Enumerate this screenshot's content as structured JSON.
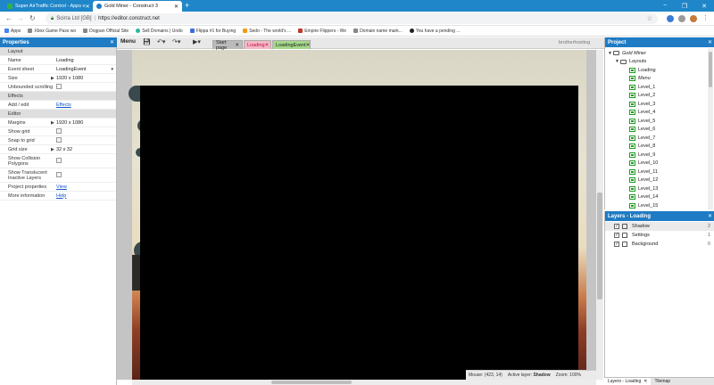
{
  "browser": {
    "tabs": [
      {
        "title": "Super AirTraffic Control - Apps o",
        "color": "#2fb34a"
      },
      {
        "title": "Gold Miner - Construct 3",
        "color": "#1e7bc4"
      }
    ],
    "new_tab": "+",
    "window_controls": [
      "−",
      "❐",
      "✕"
    ],
    "site_name": "Scirra Ltd [GB]",
    "url": "https://editor.construct.net",
    "bookmarks": [
      {
        "label": "Apps",
        "color": "#4285f4"
      },
      {
        "label": "Xbox Game Pass wo",
        "color": "#888"
      },
      {
        "label": "Dogpan Official Site",
        "color": "#888"
      },
      {
        "label": "Sell Domains | Undo",
        "color": "#2cb5a0"
      },
      {
        "label": "Flippa #1 for Buying",
        "color": "#3b6edc"
      },
      {
        "label": "Sedo - The world's ...",
        "color": "#f39c12"
      },
      {
        "label": "Empire Flippers - We",
        "color": "#c0392b"
      },
      {
        "label": "Domain name mark...",
        "color": "#888"
      },
      {
        "label": "You have a pending ...",
        "color": "#222"
      }
    ]
  },
  "editor": {
    "menu_label": "Menu",
    "layout_tabs": [
      {
        "label": "Start page"
      },
      {
        "label": "Loading"
      },
      {
        "label": "LoadingEvent"
      }
    ],
    "username": "brotherhosting"
  },
  "properties": {
    "title": "Properties",
    "rows": [
      {
        "type": "section",
        "label": "Layout"
      },
      {
        "type": "text",
        "label": "Name",
        "value": "Loading"
      },
      {
        "type": "dropdown",
        "label": "Event sheet",
        "value": "LoadingEvent"
      },
      {
        "type": "text",
        "label": "Size",
        "value": "1920 x 1080",
        "expand": true
      },
      {
        "type": "check",
        "label": "Unbounded scrolling"
      },
      {
        "type": "section",
        "label": "Effects"
      },
      {
        "type": "link",
        "label": "Add / edit",
        "value": "Effects"
      },
      {
        "type": "section",
        "label": "Editor"
      },
      {
        "type": "text",
        "label": "Margins",
        "value": "1920 x 1080",
        "expand": true
      },
      {
        "type": "check",
        "label": "Show grid"
      },
      {
        "type": "check",
        "label": "Snap to grid"
      },
      {
        "type": "text",
        "label": "Grid size",
        "value": "32 x 32",
        "expand": true
      },
      {
        "type": "check",
        "label": "Show Collision Polygons",
        "tall": true
      },
      {
        "type": "check",
        "label": "Show Translucent Inactive Layers",
        "tall": true
      },
      {
        "type": "link",
        "label": "Project properties",
        "value": "View"
      },
      {
        "type": "link",
        "label": "More information",
        "value": "Help"
      }
    ]
  },
  "status": {
    "mouse": "Mouse: (423, 14)",
    "active_layer_label": "Active layer:",
    "active_layer": "Shadow",
    "zoom": "Zoom: 100%"
  },
  "project": {
    "title": "Project",
    "root": "Gold Miner",
    "folder": "Layouts",
    "layouts": [
      "Loading",
      "Menu",
      "Level_1",
      "Level_2",
      "Level_3",
      "Level_4",
      "Level_5",
      "Level_6",
      "Level_7",
      "Level_8",
      "Level_9",
      "Level_10",
      "Level_11",
      "Level_12",
      "Level_13",
      "Level_14",
      "Level_15"
    ]
  },
  "layers": {
    "title": "Layers - Loading",
    "items": [
      {
        "name": "Shadow",
        "index": "2"
      },
      {
        "name": "Settings",
        "index": "1"
      },
      {
        "name": "Background",
        "index": "0"
      }
    ],
    "bottom_tabs": [
      "Layers - Loading",
      "Tilemap"
    ]
  },
  "colors": {
    "accent": "#1e7bc4",
    "chrome": "#1f86c9"
  }
}
